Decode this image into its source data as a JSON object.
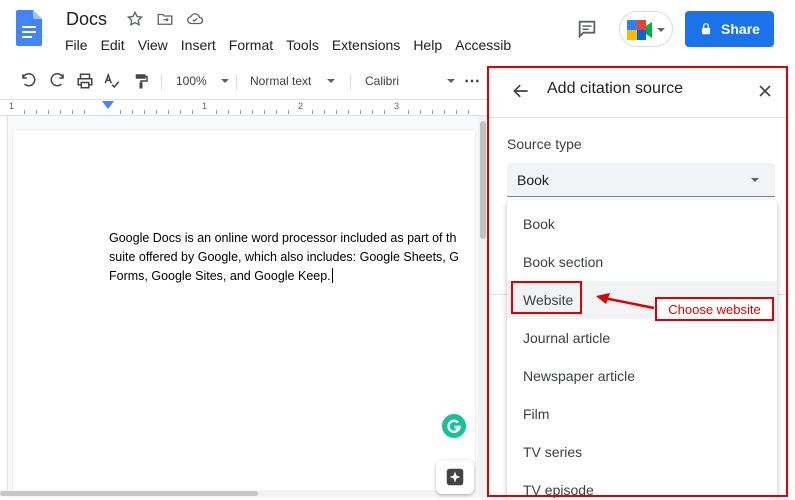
{
  "app": {
    "doc_title": "Docs",
    "menu": [
      "File",
      "Edit",
      "View",
      "Insert",
      "Format",
      "Tools",
      "Extensions",
      "Help",
      "Accessib"
    ],
    "share_label": "Share"
  },
  "toolbar": {
    "zoom": "100%",
    "style": "Normal text",
    "font": "Calibri",
    "more": "⋯"
  },
  "ruler": {
    "marks": [
      "1",
      "1",
      "2",
      "3"
    ]
  },
  "document": {
    "lines": [
      "Google Docs is an online word processor included as part of th",
      "suite offered by Google, which also includes: Google Sheets, G",
      "Forms, Google Sites, and Google Keep."
    ]
  },
  "panel": {
    "title": "Add citation source",
    "source_type_label": "Source type",
    "selected": "Book",
    "options": [
      "Book",
      "Book section",
      "Website",
      "Journal article",
      "Newspaper article",
      "Film",
      "TV series",
      "TV episode"
    ]
  },
  "annotation": {
    "label": "Choose website",
    "color": "#e00000"
  },
  "colors": {
    "accent": "#1a73e8",
    "grammarly": "#15c39a"
  }
}
